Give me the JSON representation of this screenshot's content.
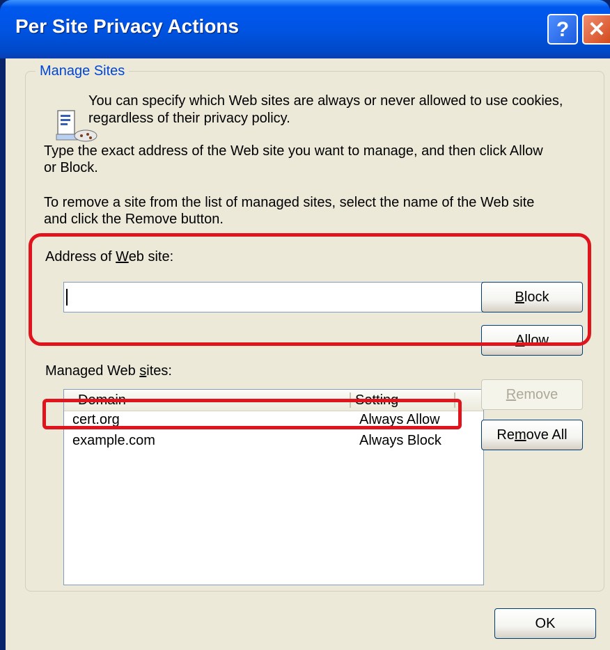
{
  "window": {
    "title": "Per Site Privacy Actions",
    "help_label": "?",
    "close_label": "✕"
  },
  "group": {
    "title": "Manage Sites",
    "intro": "You can specify which Web sites are always or never allowed to use cookies, regardless of their privacy policy.",
    "instructions_line1": "Type the exact address of the Web site you want to manage, and then click Allow",
    "instructions_line2": "or Block.",
    "remove_instructions_line1": "To remove a site from the list of managed sites, select the name of the Web site",
    "remove_instructions_line2": "and click the Remove button.",
    "address_label_pre": "Address of ",
    "address_label_hot": "W",
    "address_label_post": "eb site:",
    "address_value": "",
    "block_pre": "",
    "block_hot": "B",
    "block_post": "lock",
    "allow_pre": "",
    "allow_hot": "A",
    "allow_post": "llow",
    "managed_label_pre": "Managed Web ",
    "managed_label_hot": "s",
    "managed_label_post": "ites:",
    "columns": {
      "domain": "Domain",
      "setting": "Setting"
    },
    "sites": [
      {
        "domain": "cert.org",
        "setting": "Always Allow"
      },
      {
        "domain": "example.com",
        "setting": "Always Block"
      }
    ],
    "remove_pre": "",
    "remove_hot": "R",
    "remove_post": "emove",
    "remove_all_pre": "Re",
    "remove_all_hot": "m",
    "remove_all_post": "ove All"
  },
  "ok_label": "OK",
  "icon": "cookie-privacy-icon",
  "colors": {
    "title_bar": "#0054e3",
    "dialog_bg": "#ece9d8",
    "highlight": "#e0141c",
    "group_label": "#0046d5"
  }
}
